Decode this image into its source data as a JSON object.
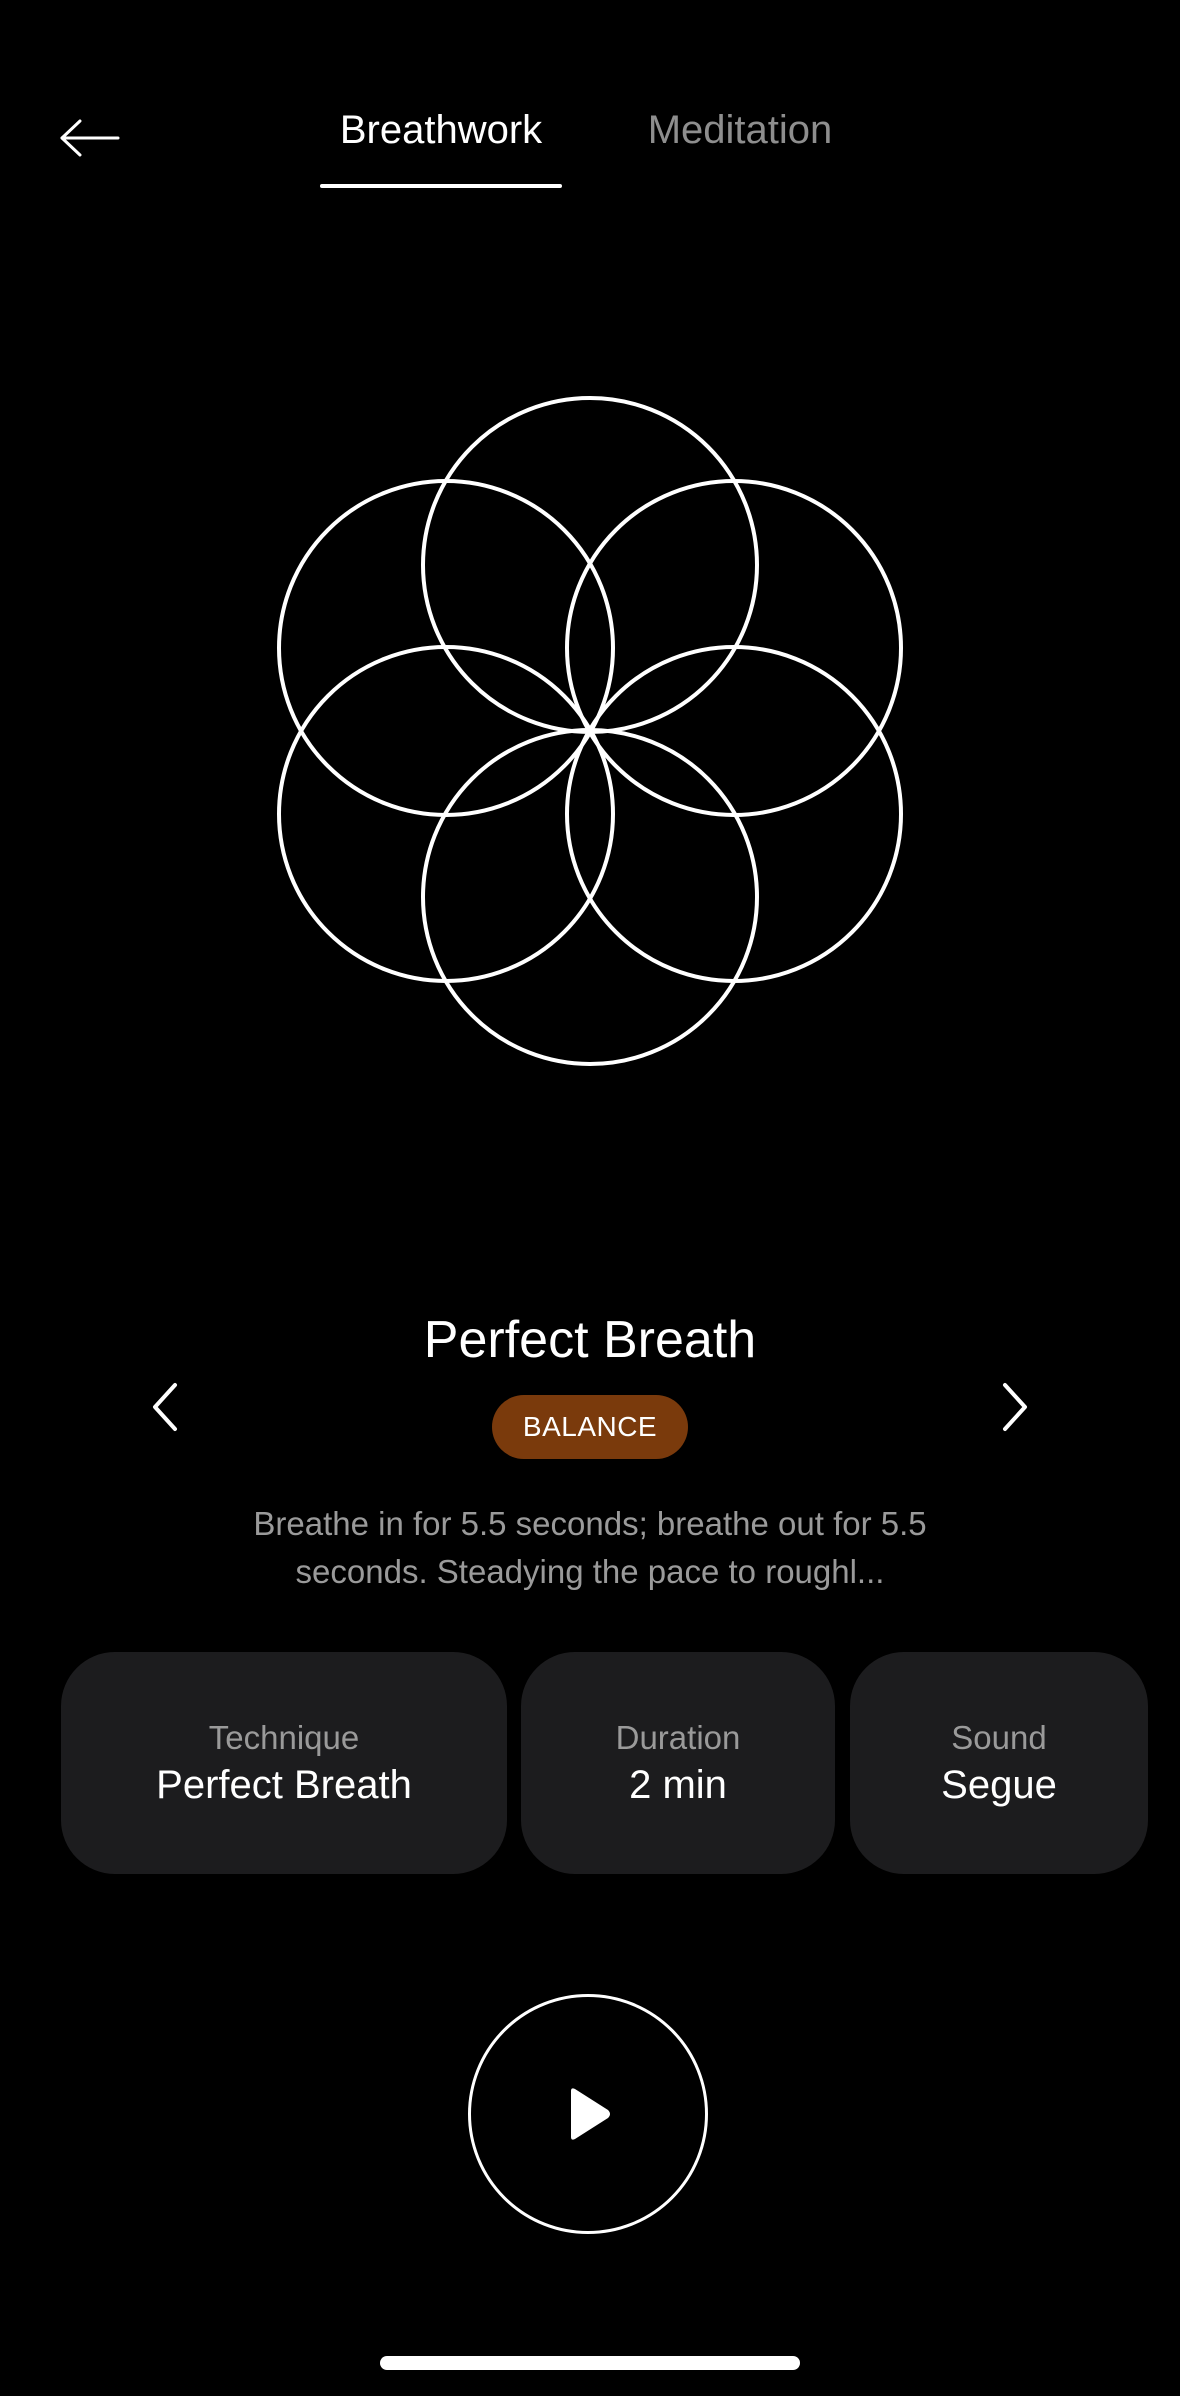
{
  "header": {
    "back_icon": "arrow-left-icon",
    "tabs": [
      {
        "label": "Breathwork",
        "active": true
      },
      {
        "label": "Meditation",
        "active": false
      }
    ]
  },
  "visual": {
    "icon": "flower-of-life-icon"
  },
  "technique": {
    "title": "Perfect Breath",
    "badge": "BALANCE",
    "badge_color": "#7a3a0c",
    "description": "Breathe in for 5.5 seconds; breathe out for 5.5 seconds. Steadying the pace to roughl...",
    "prev_icon": "chevron-left-icon",
    "next_icon": "chevron-right-icon"
  },
  "cards": [
    {
      "label": "Technique",
      "value": "Perfect Breath"
    },
    {
      "label": "Duration",
      "value": "2 min"
    },
    {
      "label": "Sound",
      "value": "Segue"
    }
  ],
  "controls": {
    "play_icon": "play-icon"
  },
  "colors": {
    "background": "#000000",
    "card_background": "#1c1c1e",
    "muted_text": "#9a9a9a",
    "inactive_tab": "#8e8e8e"
  }
}
